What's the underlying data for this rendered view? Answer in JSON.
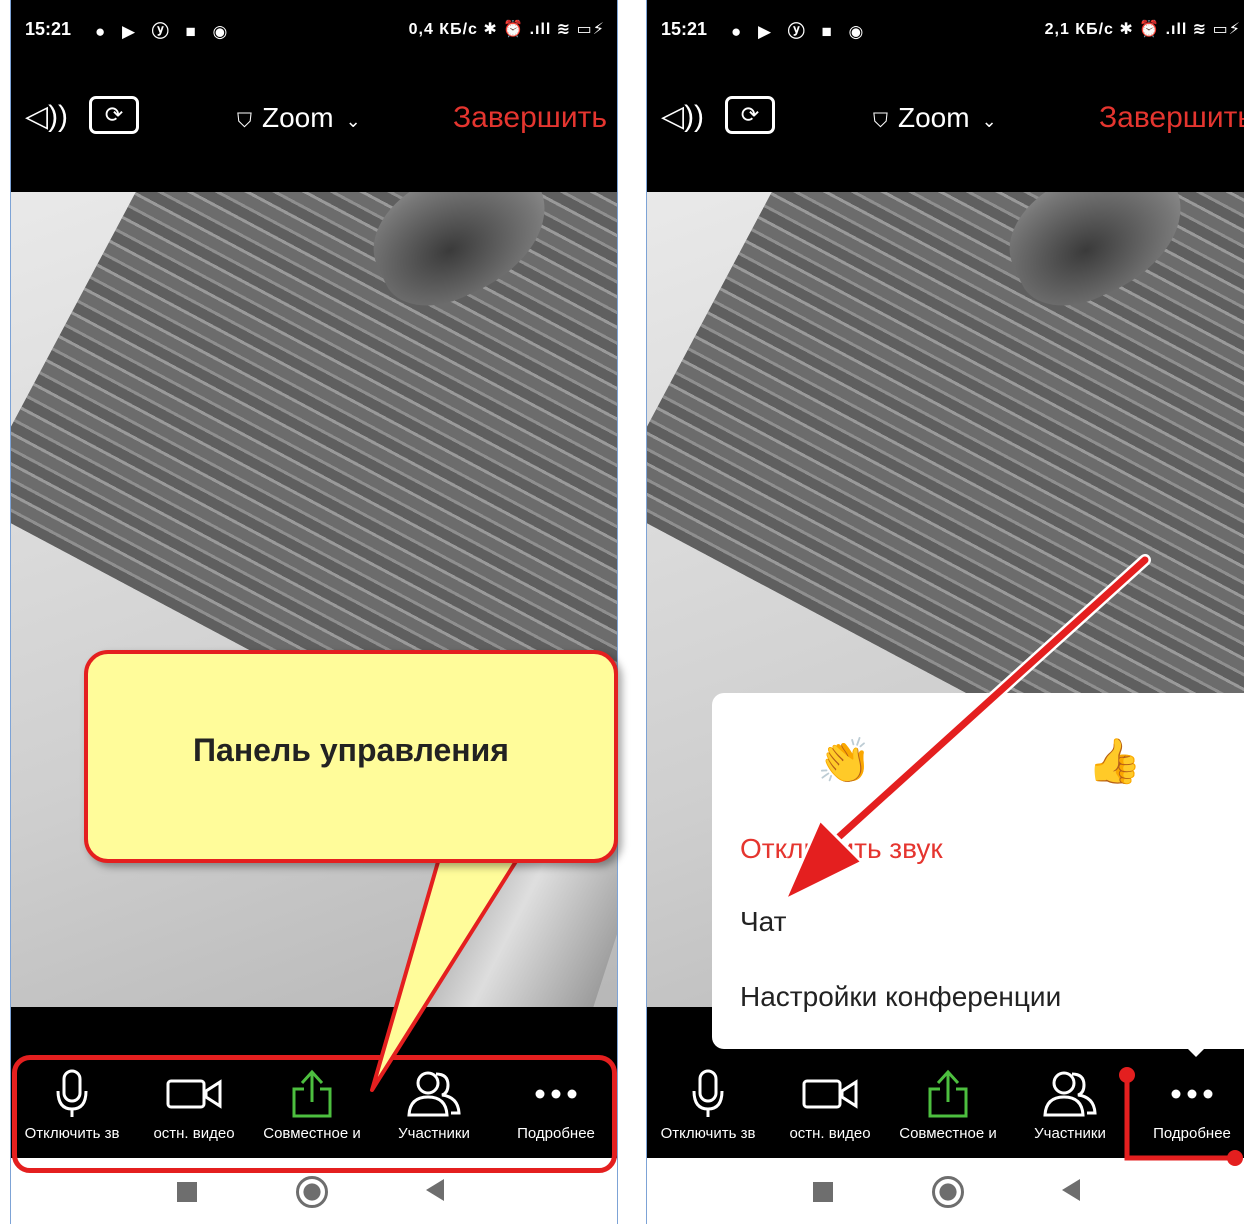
{
  "left": {
    "status": {
      "time": "15:21",
      "net": "0,4 КБ/с",
      "battery": "100"
    },
    "topbar": {
      "brand": "Zoom",
      "end_label": "Завершить"
    },
    "toolbar": [
      {
        "name": "mute",
        "label": "Отключить зв"
      },
      {
        "name": "video",
        "label": "остн. видео"
      },
      {
        "name": "share",
        "label": "Совместное и"
      },
      {
        "name": "participants",
        "label": "Участники"
      },
      {
        "name": "more",
        "label": "Подробнее"
      }
    ],
    "callout": "Панель управления"
  },
  "right": {
    "status": {
      "time": "15:21",
      "net": "2,1 КБ/с",
      "battery": "100"
    },
    "topbar": {
      "brand": "Zoom",
      "end_label": "Завершить"
    },
    "toolbar": [
      {
        "name": "mute",
        "label": "Отключить зв"
      },
      {
        "name": "video",
        "label": "остн. видео"
      },
      {
        "name": "share",
        "label": "Совместное и"
      },
      {
        "name": "participants",
        "label": "Участники"
      },
      {
        "name": "more",
        "label": "Подробнее"
      }
    ],
    "menu": {
      "reactions": [
        "clap",
        "thumbs-up"
      ],
      "mute_label": "Отключить звук",
      "chat_label": "Чат",
      "settings_label": "Настройки конференции"
    }
  },
  "colors": {
    "accent_red": "#e5352f",
    "share_green": "#4dbf3f",
    "callout_yellow": "#fffc9a"
  }
}
